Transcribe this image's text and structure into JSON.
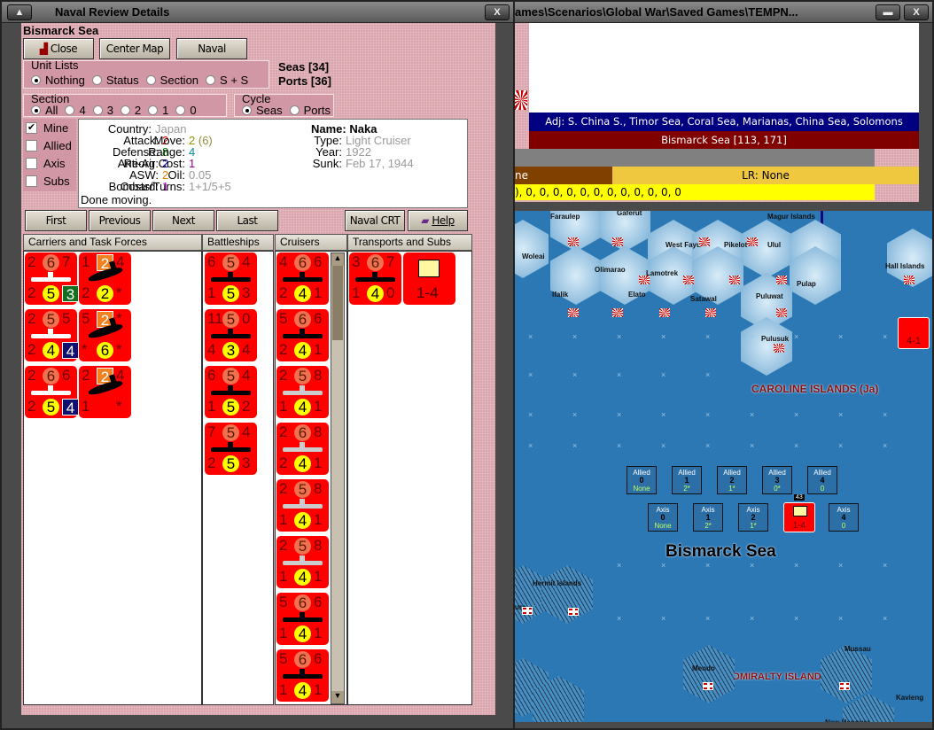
{
  "left_window": {
    "title": "Naval Review Details",
    "location": "Bismarck Sea",
    "buttons": {
      "close": "Close",
      "center_map": "Center Map",
      "naval_summary": "Naval Summary",
      "first": "First",
      "previous": "Previous",
      "next": "Next",
      "last": "Last",
      "naval_crt": "Naval CRT",
      "help": "Help"
    },
    "unit_lists": {
      "label": "Unit Lists",
      "options": [
        "Nothing",
        "Status",
        "Section",
        "S + S"
      ],
      "selected": "Nothing"
    },
    "seas": "Seas [34]",
    "ports": "Ports [36]",
    "section": {
      "label": "Section",
      "options": [
        "All",
        "4",
        "3",
        "2",
        "1",
        "0"
      ],
      "selected": "All"
    },
    "cycle": {
      "label": "Cycle",
      "options": [
        "Seas",
        "Ports"
      ],
      "selected": "Seas"
    },
    "filters": [
      {
        "label": "Mine",
        "checked": true
      },
      {
        "label": "Allied",
        "checked": false
      },
      {
        "label": "Axis",
        "checked": false
      },
      {
        "label": "Subs",
        "checked": false
      }
    ],
    "info": {
      "country_l": "Country:",
      "country": "Japan",
      "attack_l": "Attack:",
      "attack": "2",
      "defense_l": "Defense:",
      "defense": "8",
      "aa_l": "Anti-Air:",
      "aa": "2",
      "asw_l": "ASW:",
      "asw": "2",
      "bombard_l": "Bombard:",
      "bombard": "1",
      "status": "Done moving.",
      "name_l": "Name:",
      "name": "Naka",
      "move_l": "Move:",
      "move": "2",
      "move_extra": "(6)",
      "range_l": "Range:",
      "range": "4",
      "reorg_l": "Reorg Cost:",
      "reorg": "1",
      "oil_l": "Oil:",
      "oil": "0.05",
      "costs_l": "Costs/Turns:",
      "costs": "1+1/5+5",
      "type_l": "Type:",
      "type": "Light Cruiser",
      "year_l": "Year:",
      "year": "1922",
      "sunk_l": "Sunk:",
      "sunk": "Feb 17, 1944"
    },
    "columns": [
      "Carriers and Task Forces",
      "Battleships",
      "Cruisers",
      "Transports and Subs"
    ]
  },
  "counters": {
    "carriers": [
      {
        "kind": "carrier",
        "t": [
          "2",
          "6",
          "7"
        ],
        "b": [
          "2",
          "5",
          "3"
        ],
        "tb": "bo",
        "bb": "by",
        "rb": "bbg"
      },
      {
        "kind": "plane",
        "t": [
          "1",
          "2",
          "4"
        ],
        "b": [
          "2",
          "2",
          "*"
        ],
        "tb": "bbo",
        "bb": "by"
      },
      {
        "kind": "carrier",
        "t": [
          "2",
          "5",
          "5"
        ],
        "b": [
          "2",
          "4",
          "4"
        ],
        "tb": "bo",
        "bb": "by",
        "rb": "bbn"
      },
      {
        "kind": "plane",
        "t": [
          "5",
          "2",
          "*"
        ],
        "b": [
          "*",
          "6",
          "*"
        ],
        "tb": "bbo",
        "bb": "by"
      },
      {
        "kind": "carrier",
        "t": [
          "2",
          "6",
          "6"
        ],
        "b": [
          "2",
          "5",
          "4"
        ],
        "tb": "bo",
        "bb": "by",
        "rb": "bbn"
      },
      {
        "kind": "plane",
        "t": [
          "2",
          "2",
          "4"
        ],
        "b": [
          "1",
          "",
          "*"
        ],
        "tb": "bbo",
        "bb": ""
      }
    ],
    "battleships": [
      {
        "kind": "ship",
        "t": [
          "6",
          "5",
          "4"
        ],
        "b": [
          "1",
          "5",
          "3"
        ]
      },
      {
        "kind": "ship",
        "t": [
          "11",
          "5",
          "0"
        ],
        "b": [
          "4",
          "3",
          "4"
        ]
      },
      {
        "kind": "ship",
        "t": [
          "6",
          "5",
          "4"
        ],
        "b": [
          "1",
          "5",
          "2"
        ]
      },
      {
        "kind": "ship",
        "t": [
          "7",
          "5",
          "4"
        ],
        "b": [
          "2",
          "5",
          "3"
        ]
      }
    ],
    "cruisers": [
      {
        "kind": "ship",
        "t": [
          "4",
          "6",
          "6"
        ],
        "b": [
          "2",
          "4",
          "1"
        ]
      },
      {
        "kind": "ship",
        "t": [
          "5",
          "6",
          "6"
        ],
        "b": [
          "2",
          "4",
          "1"
        ]
      },
      {
        "kind": "grey",
        "t": [
          "2",
          "5",
          "8"
        ],
        "b": [
          "1",
          "4",
          "1"
        ]
      },
      {
        "kind": "grey",
        "t": [
          "2",
          "6",
          "8"
        ],
        "b": [
          "2",
          "4",
          "1"
        ]
      },
      {
        "kind": "grey",
        "t": [
          "2",
          "5",
          "8"
        ],
        "b": [
          "1",
          "4",
          "1"
        ]
      },
      {
        "kind": "grey",
        "t": [
          "2",
          "5",
          "8"
        ],
        "b": [
          "1",
          "4",
          "1"
        ]
      },
      {
        "kind": "ship",
        "t": [
          "5",
          "6",
          "6"
        ],
        "b": [
          "1",
          "4",
          "1"
        ]
      },
      {
        "kind": "ship",
        "t": [
          "5",
          "6",
          "6"
        ],
        "b": [
          "1",
          "4",
          "1"
        ]
      }
    ],
    "transports": [
      {
        "kind": "ship",
        "t": [
          "3",
          "6",
          "7"
        ],
        "b": [
          "1",
          "4",
          "0"
        ]
      }
    ],
    "hq_label": "1-4"
  },
  "right_window": {
    "title": "ames\\Scenarios\\Global War\\Saved Games\\TEMPN...",
    "adj": "Adj: S. China S., Timor Sea, Coral Sea, Marianas, China Sea, Solomons",
    "hex": "Bismarck Sea [113, 171]",
    "brown": "ne",
    "lr": "LR: None",
    "yellow": "), 0, 0, 0, 0, 0, 0, 0, 0, 0, 0, 0, 0"
  },
  "map": {
    "sea_name": "Bismarck Sea",
    "region1": "CAROLINE ISLANDS (Ja)",
    "region2": "ADMIRALTY ISLANDS",
    "islands": [
      "Faraulep",
      "Gaferut",
      "Magur Islands",
      "Woleai",
      "West Fayu",
      "Pikelot",
      "Ulul",
      "Hall Islands",
      "Olimarao",
      "Lamotrek",
      "Ifalik",
      "Elato",
      "Satawal",
      "Pulap",
      "Puluwat",
      "Pulusuk",
      "Hermit Islands",
      "Mendo",
      "Mussau",
      "New Hanover",
      "Kavieng",
      "ura"
    ],
    "enemy_unit": "4-1",
    "unit_stack_count": "43",
    "allied_stacks": [
      {
        "s": "Allied",
        "n": "0",
        "v": "None"
      },
      {
        "s": "Allied",
        "n": "1",
        "v": "2*"
      },
      {
        "s": "Allied",
        "n": "2",
        "v": "1*"
      },
      {
        "s": "Allied",
        "n": "3",
        "v": "0*"
      },
      {
        "s": "Allied",
        "n": "4",
        "v": "0"
      }
    ],
    "axis_stacks": [
      {
        "s": "Axis",
        "n": "0",
        "v": "None"
      },
      {
        "s": "Axis",
        "n": "1",
        "v": "2*"
      },
      {
        "s": "Axis",
        "n": "2",
        "v": "1*"
      },
      {
        "s": "Axis",
        "n": "4",
        "v": "0"
      }
    ],
    "own_unit": "1-4"
  },
  "colors": {
    "counter": "#ff0000",
    "adj_bar": "#000080",
    "hex_bar": "#800000",
    "sea": "#2b78b5",
    "pink": "#d9a6ad"
  }
}
